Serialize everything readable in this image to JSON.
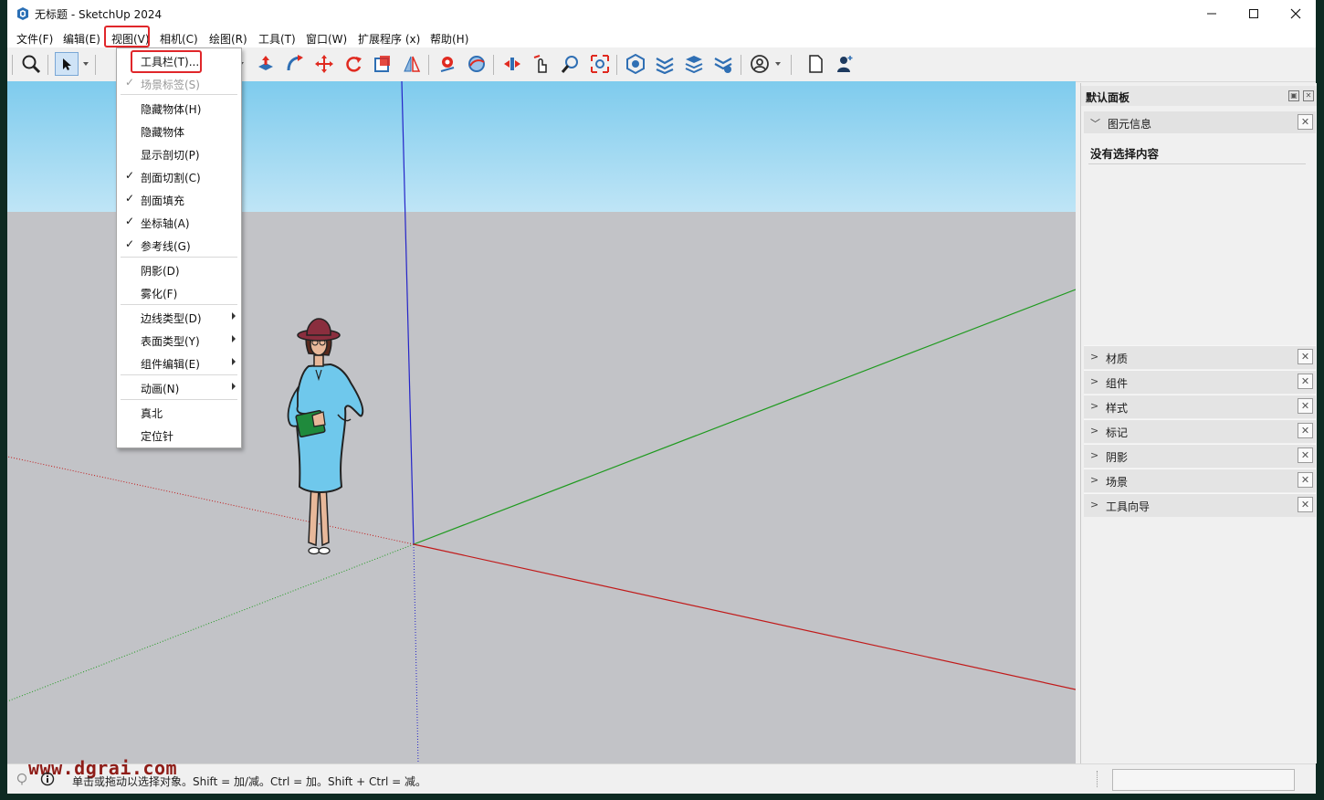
{
  "window": {
    "title": "无标题 - SketchUp 2024"
  },
  "menubar": {
    "items": [
      "文件(F)",
      "编辑(E)",
      "视图(V)",
      "相机(C)",
      "绘图(R)",
      "工具(T)",
      "窗口(W)",
      "扩展程序 (x)",
      "帮助(H)"
    ]
  },
  "view_menu": {
    "items": [
      {
        "label": "工具栏(T)...",
        "checked": false,
        "disabled": false,
        "submenu": false
      },
      {
        "label": "场景标签(S)",
        "checked": true,
        "disabled": true,
        "submenu": false
      },
      {
        "label": "隐藏物体(H)",
        "checked": false,
        "disabled": false,
        "submenu": false
      },
      {
        "label": "隐藏物体",
        "checked": false,
        "disabled": false,
        "submenu": false
      },
      {
        "label": "显示剖切(P)",
        "checked": false,
        "disabled": false,
        "submenu": false
      },
      {
        "label": "剖面切割(C)",
        "checked": true,
        "disabled": false,
        "submenu": false
      },
      {
        "label": "剖面填充",
        "checked": true,
        "disabled": false,
        "submenu": false
      },
      {
        "label": "坐标轴(A)",
        "checked": true,
        "disabled": false,
        "submenu": false
      },
      {
        "label": "参考线(G)",
        "checked": true,
        "disabled": false,
        "submenu": false
      },
      {
        "label": "阴影(D)",
        "checked": false,
        "disabled": false,
        "submenu": false
      },
      {
        "label": "雾化(F)",
        "checked": false,
        "disabled": false,
        "submenu": false
      },
      {
        "label": "边线类型(D)",
        "checked": false,
        "disabled": false,
        "submenu": true
      },
      {
        "label": "表面类型(Y)",
        "checked": false,
        "disabled": false,
        "submenu": true
      },
      {
        "label": "组件编辑(E)",
        "checked": false,
        "disabled": false,
        "submenu": true
      },
      {
        "label": "动画(N)",
        "checked": false,
        "disabled": false,
        "submenu": true
      },
      {
        "label": "真北",
        "checked": false,
        "disabled": false,
        "submenu": false
      },
      {
        "label": "定位针",
        "checked": false,
        "disabled": false,
        "submenu": false
      }
    ]
  },
  "panel": {
    "title": "默认面板",
    "entity_info": {
      "title": "图元信息",
      "content": "没有选择内容"
    },
    "trays": [
      "材质",
      "组件",
      "样式",
      "标记",
      "阴影",
      "场景",
      "工具向导"
    ]
  },
  "status": {
    "text": "单击或拖动以选择对象。Shift = 加/减。Ctrl = 加。Shift + Ctrl = 减。",
    "watermark": "www.dgrai.com"
  },
  "colors": {
    "highlight": "#e0262a",
    "axis_red": "#c11a1a",
    "axis_green": "#1f9a1f",
    "axis_blue": "#2424c8",
    "sky": "#9fd8f1",
    "ground": "#c2c3c7"
  },
  "icons": {
    "toolbar": [
      "zoom-icon",
      "select-icon",
      "pushpull-icon",
      "followme-icon",
      "move-icon",
      "rotate-icon",
      "scale-icon",
      "flip-icon",
      "position-camera-icon",
      "orbit-icon",
      "pan-icon",
      "walk-icon",
      "zoom-window-icon",
      "zoom-extents-icon",
      "warehouse-icon",
      "extension-warehouse-icon",
      "layout-icon",
      "extension-manager-icon",
      "account-icon",
      "new-file-icon",
      "user-icon"
    ]
  }
}
